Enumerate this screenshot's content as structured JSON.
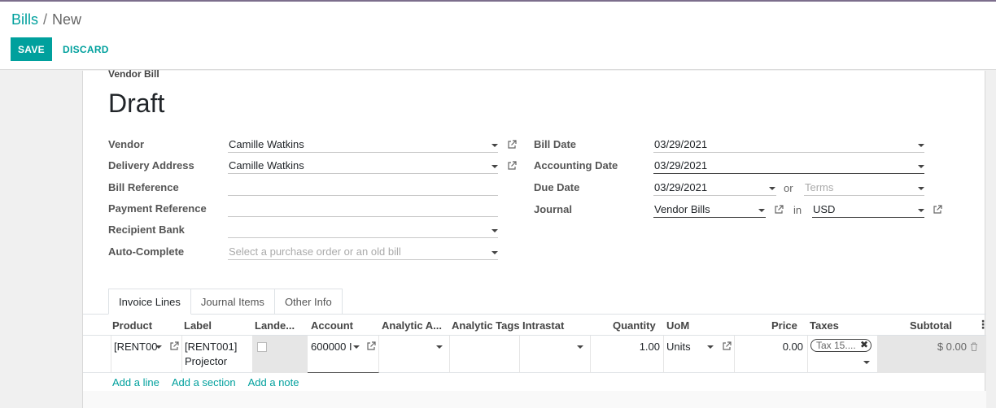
{
  "breadcrumb": {
    "parent": "Bills",
    "separator": "/",
    "current": "New"
  },
  "buttons": {
    "save": "SAVE",
    "discard": "DISCARD"
  },
  "doc": {
    "type": "Vendor Bill",
    "state": "Draft"
  },
  "form": {
    "vendor": {
      "label": "Vendor",
      "value": "Camille Watkins"
    },
    "delivery_address": {
      "label": "Delivery Address",
      "value": "Camille Watkins"
    },
    "bill_reference": {
      "label": "Bill Reference",
      "value": ""
    },
    "payment_reference": {
      "label": "Payment Reference",
      "value": ""
    },
    "recipient_bank": {
      "label": "Recipient Bank",
      "value": ""
    },
    "auto_complete": {
      "label": "Auto-Complete",
      "placeholder": "Select a purchase order or an old bill"
    },
    "bill_date": {
      "label": "Bill Date",
      "value": "03/29/2021"
    },
    "accounting_date": {
      "label": "Accounting Date",
      "value": "03/29/2021"
    },
    "due_date": {
      "label": "Due Date",
      "value": "03/29/2021",
      "or": "or",
      "terms_placeholder": "Terms"
    },
    "journal": {
      "label": "Journal",
      "value": "Vendor Bills",
      "in": "in",
      "currency": "USD"
    }
  },
  "tabs": [
    {
      "label": "Invoice Lines",
      "active": true
    },
    {
      "label": "Journal Items",
      "active": false
    },
    {
      "label": "Other Info",
      "active": false
    }
  ],
  "table": {
    "columns": [
      "Product",
      "Label",
      "Lande...",
      "Account",
      "Analytic A...",
      "Analytic Tags",
      "Intrastat",
      "Quantity",
      "UoM",
      "Price",
      "Taxes",
      "Subtotal"
    ],
    "row": {
      "product": "[RENT00",
      "label_line1": "[RENT001]",
      "label_line2": "Projector",
      "account": "600000 I",
      "quantity": "1.00",
      "uom": "Units",
      "price": "0.00",
      "tax": "Tax 15....",
      "subtotal": "$ 0.00"
    }
  },
  "line_actions": {
    "add_line": "Add a line",
    "add_section": "Add a section",
    "add_note": "Add a note"
  },
  "colors": {
    "accent": "#00a09d",
    "topbar": "#7c6e8c"
  }
}
